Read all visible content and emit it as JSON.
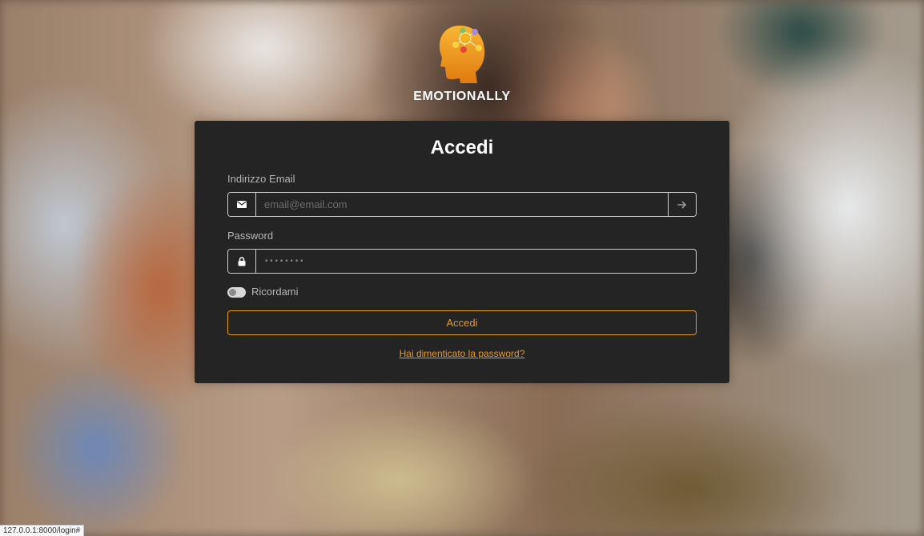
{
  "brand": {
    "name": "EMOTIONALLY",
    "logo_icon": "head-emotions-logo",
    "logo_color": "#f5a01a"
  },
  "login": {
    "title": "Accedi",
    "email_label": "Indirizzo Email",
    "email_placeholder": "email@email.com",
    "email_icon": "envelope-icon",
    "arrow_icon": "arrow-right-icon",
    "password_label": "Password",
    "password_value": "••••••••",
    "password_icon": "lock-icon",
    "remember_label": "Ricordami",
    "remember_checked": false,
    "submit_label": "Accedi",
    "forgot_link": "Hai dimenticato la password?"
  },
  "status_bar": {
    "url": "127.0.0.1:8000/login#"
  },
  "colors": {
    "card_bg": "#242424",
    "accent": "#e39a2a",
    "text": "#ffffff"
  }
}
